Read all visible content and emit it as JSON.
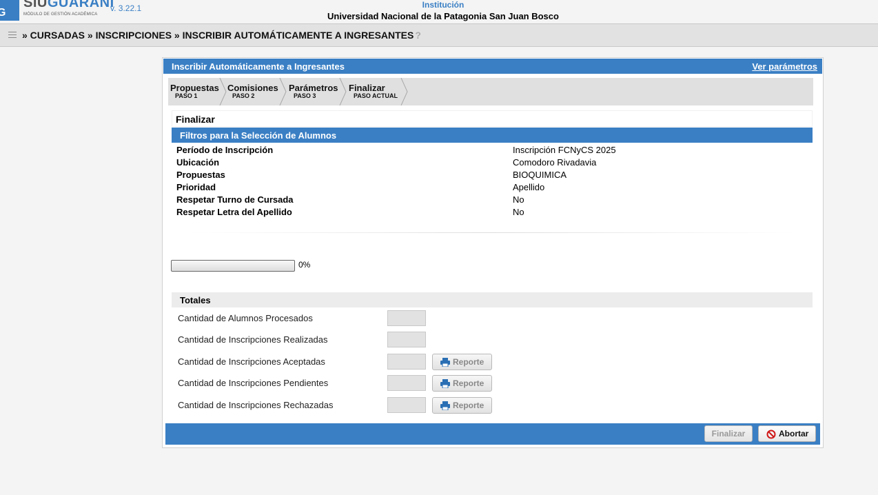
{
  "app": {
    "logo_siu": "SIU",
    "logo_guarani": "GUARANI",
    "logo_subtitle": "MÓDULO DE GESTIÓN ACADÉMICA",
    "version": "v. 3.22.1",
    "institution_label": "Institución",
    "institution_name": "Universidad Nacional de la Patagonia San Juan Bosco"
  },
  "breadcrumb": {
    "text": "» CURSADAS » INSCRIPCIONES » INSCRIBIR AUTOMÁTICAMENTE A INGRESANTES"
  },
  "panel": {
    "title": "Inscribir Automáticamente a Ingresantes",
    "params_link": "Ver parámetros"
  },
  "wizard": {
    "steps": [
      {
        "title": "Propuestas",
        "sub": "PASO 1"
      },
      {
        "title": "Comisiones",
        "sub": "PASO 2"
      },
      {
        "title": "Parámetros",
        "sub": "PASO 3"
      },
      {
        "title": "Finalizar",
        "sub": "PASO ACTUAL"
      }
    ]
  },
  "section_title": "Finalizar",
  "filters": {
    "title": "Filtros para la Selección de Alumnos",
    "rows": [
      {
        "label": "Período de Inscripción",
        "value": "Inscripción FCNyCS 2025"
      },
      {
        "label": "Ubicación",
        "value": "Comodoro Rivadavia"
      },
      {
        "label": "Propuestas",
        "value": "BIOQUIMICA"
      },
      {
        "label": "Prioridad",
        "value": "Apellido"
      },
      {
        "label": "Respetar Turno de Cursada",
        "value": "No"
      },
      {
        "label": "Respetar Letra del Apellido",
        "value": "No"
      }
    ]
  },
  "progress": {
    "percent_value": 0,
    "percent_label": "0%"
  },
  "totals": {
    "title": "Totales",
    "rows": [
      {
        "label": "Cantidad de Alumnos Procesados",
        "value": ""
      },
      {
        "label": "Cantidad de Inscripciones Realizadas",
        "value": ""
      },
      {
        "label": "Cantidad de Inscripciones Aceptadas",
        "value": "",
        "report": "Reporte"
      },
      {
        "label": "Cantidad de Inscripciones Pendientes",
        "value": "",
        "report": "Reporte"
      },
      {
        "label": "Cantidad de Inscripciones Rechazadas",
        "value": "",
        "report": "Reporte"
      }
    ]
  },
  "footer": {
    "finalizar": "Finalizar",
    "abortar": "Abortar"
  },
  "colors": {
    "accent": "#3a7fc4",
    "disabled_text": "#999999"
  },
  "icons": {
    "menu": "menu-list-icon",
    "help": "help-icon",
    "print": "printer-icon",
    "abort": "no-entry-icon"
  }
}
